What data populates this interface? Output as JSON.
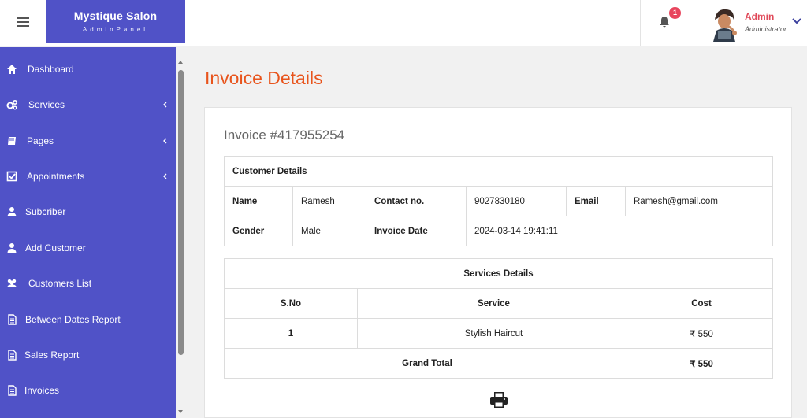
{
  "header": {
    "brand_name": "Mystique Salon",
    "brand_sub": "AdminPanel",
    "notification_count": "1",
    "user_name": "Admin",
    "user_role": "Administrator"
  },
  "sidebar": {
    "items": [
      {
        "label": "Dashboard",
        "icon": "home-icon",
        "has_submenu": false
      },
      {
        "label": "Services",
        "icon": "cogs-icon",
        "has_submenu": true
      },
      {
        "label": "Pages",
        "icon": "book-icon",
        "has_submenu": true
      },
      {
        "label": "Appointments",
        "icon": "check-square-icon",
        "has_submenu": true
      },
      {
        "label": "Subcriber",
        "icon": "user-icon",
        "has_submenu": false
      },
      {
        "label": "Add Customer",
        "icon": "user-icon",
        "has_submenu": false
      },
      {
        "label": "Customers List",
        "icon": "users-icon",
        "has_submenu": false
      },
      {
        "label": "Between Dates Report",
        "icon": "file-icon",
        "has_submenu": false
      },
      {
        "label": "Sales Report",
        "icon": "file-icon",
        "has_submenu": false
      },
      {
        "label": "Invoices",
        "icon": "file-icon",
        "has_submenu": false
      }
    ]
  },
  "main": {
    "page_title": "Invoice Details",
    "invoice_label": "Invoice #417955254",
    "customer": {
      "section_title": "Customer Details",
      "name_label": "Name",
      "name_value": "Ramesh",
      "contact_label": "Contact no.",
      "contact_value": "9027830180",
      "email_label": "Email",
      "email_value": "Ramesh@gmail.com",
      "gender_label": "Gender",
      "gender_value": "Male",
      "date_label": "Invoice Date",
      "date_value": "2024-03-14 19:41:11"
    },
    "services": {
      "section_title": "Services Details",
      "columns": [
        "S.No",
        "Service",
        "Cost"
      ],
      "rows": [
        {
          "sno": "1",
          "service": "Stylish Haircut",
          "cost": "₹ 550"
        }
      ],
      "grand_total_label": "Grand Total",
      "grand_total_value": "₹ 550"
    }
  },
  "colors": {
    "sidebar_bg": "#5052c7",
    "title_orange": "#e8541c",
    "badge_red": "#e8455d",
    "admin_red": "#e04a5a"
  }
}
